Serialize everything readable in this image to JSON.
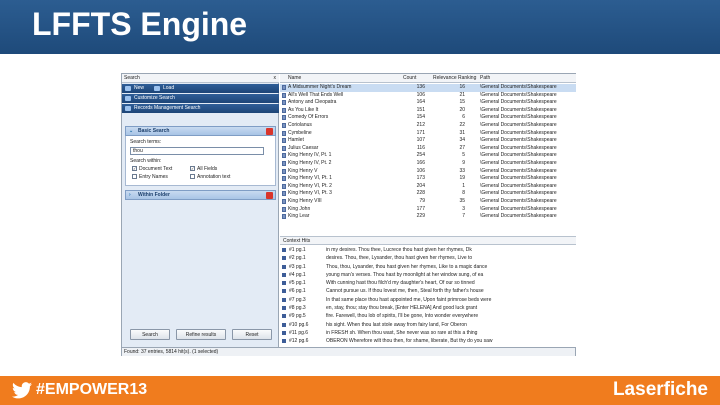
{
  "slide": {
    "title": "LFFTS Engine"
  },
  "footer": {
    "hashtag": "#EMPOWER13",
    "brand": "Laserfiche"
  },
  "left_panel": {
    "header": "Search",
    "close": "x",
    "new_label": "New",
    "load_label": "Load",
    "customize": "Customize Search",
    "records": "Records Management Search",
    "basic_search": "Basic Search",
    "search_terms_label": "Search terms:",
    "search_terms_value": "thou",
    "search_within_label": "Search within:",
    "opt_document_text": "Document Text",
    "opt_all_fields": "All Fields",
    "opt_entry_names": "Entry Names",
    "opt_annotation_text": "Annotation text",
    "check": "✓",
    "within_folder": "Within Folder",
    "btn_search": "Search",
    "btn_refine": "Refine results",
    "btn_reset": "Reset"
  },
  "table": {
    "columns": [
      "Name",
      "Count",
      "Relevance Ranking",
      "Path"
    ],
    "rows": [
      [
        "A Midsummer Night's Dream",
        "136",
        "16",
        "\\General Documents\\Shakespeare"
      ],
      [
        "All's Well That Ends Well",
        "106",
        "21",
        "\\General Documents\\Shakespeare"
      ],
      [
        "Antony and Cleopatra",
        "164",
        "15",
        "\\General Documents\\Shakespeare"
      ],
      [
        "As You Like It",
        "151",
        "20",
        "\\General Documents\\Shakespeare"
      ],
      [
        "Comedy Of Errors",
        "154",
        "6",
        "\\General Documents\\Shakespeare"
      ],
      [
        "Coriolanus",
        "212",
        "22",
        "\\General Documents\\Shakespeare"
      ],
      [
        "Cymbeline",
        "171",
        "31",
        "\\General Documents\\Shakespeare"
      ],
      [
        "Hamlet",
        "107",
        "34",
        "\\General Documents\\Shakespeare"
      ],
      [
        "Julius Caesar",
        "116",
        "27",
        "\\General Documents\\Shakespeare"
      ],
      [
        "King Henry IV, Pt. 1",
        "254",
        "5",
        "\\General Documents\\Shakespeare"
      ],
      [
        "King Henry IV, Pt. 2",
        "166",
        "9",
        "\\General Documents\\Shakespeare"
      ],
      [
        "King Henry V",
        "106",
        "33",
        "\\General Documents\\Shakespeare"
      ],
      [
        "King Henry VI, Pt. 1",
        "173",
        "19",
        "\\General Documents\\Shakespeare"
      ],
      [
        "King Henry VI, Pt. 2",
        "204",
        "1",
        "\\General Documents\\Shakespeare"
      ],
      [
        "King Henry VI, Pt. 3",
        "228",
        "8",
        "\\General Documents\\Shakespeare"
      ],
      [
        "King Henry VIII",
        "79",
        "35",
        "\\General Documents\\Shakespeare"
      ],
      [
        "King John",
        "177",
        "3",
        "\\General Documents\\Shakespeare"
      ],
      [
        "King Lear",
        "229",
        "7",
        "\\General Documents\\Shakespeare"
      ]
    ],
    "context_hits_label": "Context Hits"
  },
  "hits": [
    [
      "#1 pg.1",
      "in my desires.     Thou thee, Lucrece thou hast given her rhymes,     Dk"
    ],
    [
      "#2 pg.1",
      "desires.     Thou, thee, Lysander, thou hast given her rhymes,     Live to"
    ],
    [
      "#3 pg.1",
      "Thou, thou, Lysander, thou hast given her rhymes,     Like to a magic dance"
    ],
    [
      "#4 pg.1",
      "young man's verses.   Thou hast by moonlight at her window sung,     of ea"
    ],
    [
      "#5 pg.1",
      "With cunning hast thou filch'd my daughter's heart,     Of our so tinned"
    ],
    [
      "#6 pg.1",
      "Cannot pursue us.  If thou lovest me, then,     Steal forth thy father's house"
    ],
    [
      "#7 pg.3",
      "In that same place thou hast appointed me,     Upon faint primrose beds were"
    ],
    [
      "#8 pg.3",
      "en, stay, thou; stay thou break,     [Enter HELENA]     And good luck grant"
    ],
    [
      "#9 pg.5",
      "fire.  Farewell, thou lob of spirits, I'll be gone,     Into wonder everywhere"
    ],
    [
      "#10 pg.6",
      "his sight.  When thou last stole away from fairy land,     For Oberon"
    ],
    [
      "#11 pg.6",
      "in FRESH sh. When thou wast,     She never was so rare at this a thing"
    ],
    [
      "#12 pg.6",
      "OBERON Wherefore wilt thou then, for shame, liberate,     But thy do you saw"
    ]
  ],
  "status": "Found: 37 entries, 5814 hit(s). (1 selected)"
}
